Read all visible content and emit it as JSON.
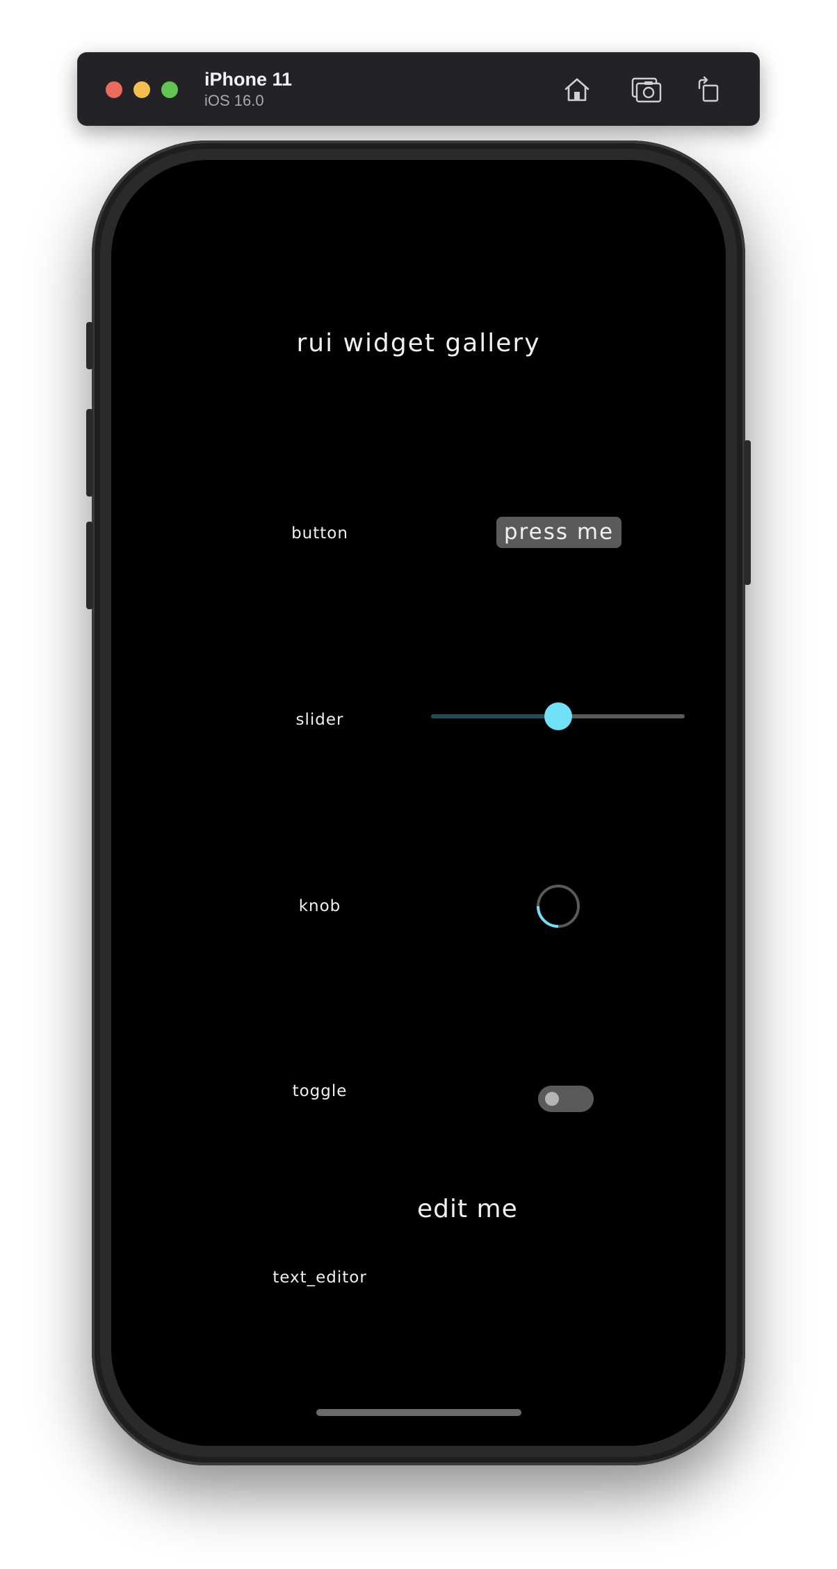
{
  "simulator": {
    "device_name": "iPhone 11",
    "os_version": "iOS 16.0",
    "toolbar": {
      "home_icon": "home-icon",
      "screenshot_icon": "screenshot-icon",
      "rotate_icon": "rotate-icon"
    },
    "window_controls": {
      "close_color": "#ed6a5e",
      "minimize_color": "#f4bf4f",
      "zoom_color": "#61c554"
    }
  },
  "app": {
    "title": "rui widget gallery",
    "rows": [
      {
        "label": "button"
      },
      {
        "label": "slider"
      },
      {
        "label": "knob"
      },
      {
        "label": "toggle"
      },
      {
        "label": "text_editor"
      }
    ],
    "button": {
      "label": "press me"
    },
    "slider": {
      "value": 0.5
    },
    "knob": {
      "value": 0.25
    },
    "toggle": {
      "on": false
    },
    "text_editor": {
      "value": "edit me"
    },
    "colors": {
      "accent": "#6fe0f5",
      "control_gray": "#5a5a5a",
      "slider_fill": "#1f4d57",
      "background": "#000000",
      "text": "#f0f0f0"
    }
  }
}
